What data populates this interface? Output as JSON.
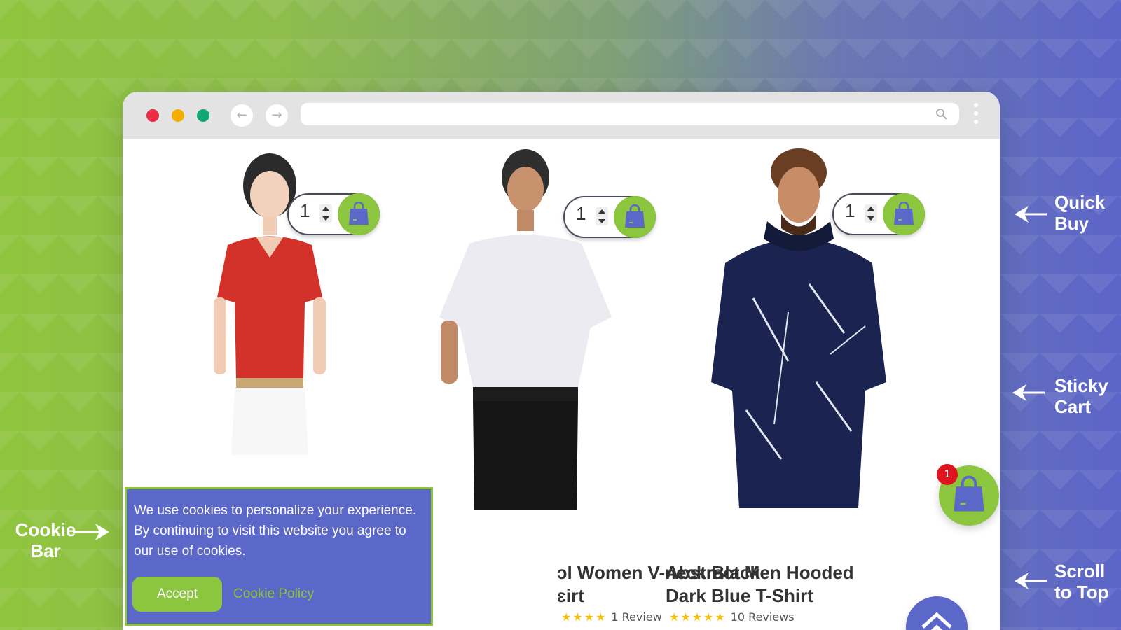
{
  "browser": {
    "window_buttons": [
      "close",
      "minimize",
      "maximize"
    ],
    "back_icon": "←",
    "forward_icon": "→",
    "address_value": ""
  },
  "products": [
    {
      "name": "",
      "quantity": "1",
      "rating": "★★★★★",
      "reviews": ""
    },
    {
      "name": "ɔl Women V-neck Black\nɛirt",
      "quantity": "1",
      "rating": "★★★★",
      "reviews": "1 Review"
    },
    {
      "name": "Abstract Men Hooded\nDark Blue T-Shirt",
      "quantity": "1",
      "rating": "★★★★★",
      "reviews": "10 Reviews"
    }
  ],
  "sticky_cart": {
    "count": "1"
  },
  "cookie_bar": {
    "message": "We use cookies to personalize your experience. By continuing to visit this website you agree to our use of cookies.",
    "accept_label": "Accept",
    "policy_label": "Cookie Policy"
  },
  "callouts": {
    "quick_buy": "Quick\nBuy",
    "sticky_cart": "Sticky\nCart",
    "scroll_to_top": "Scroll\nto Top",
    "cookie_bar": "Cookie\nBar"
  },
  "colors": {
    "accent_green": "#8cc63f",
    "accent_blue": "#5c68c9",
    "badge_red": "#e0141e"
  }
}
